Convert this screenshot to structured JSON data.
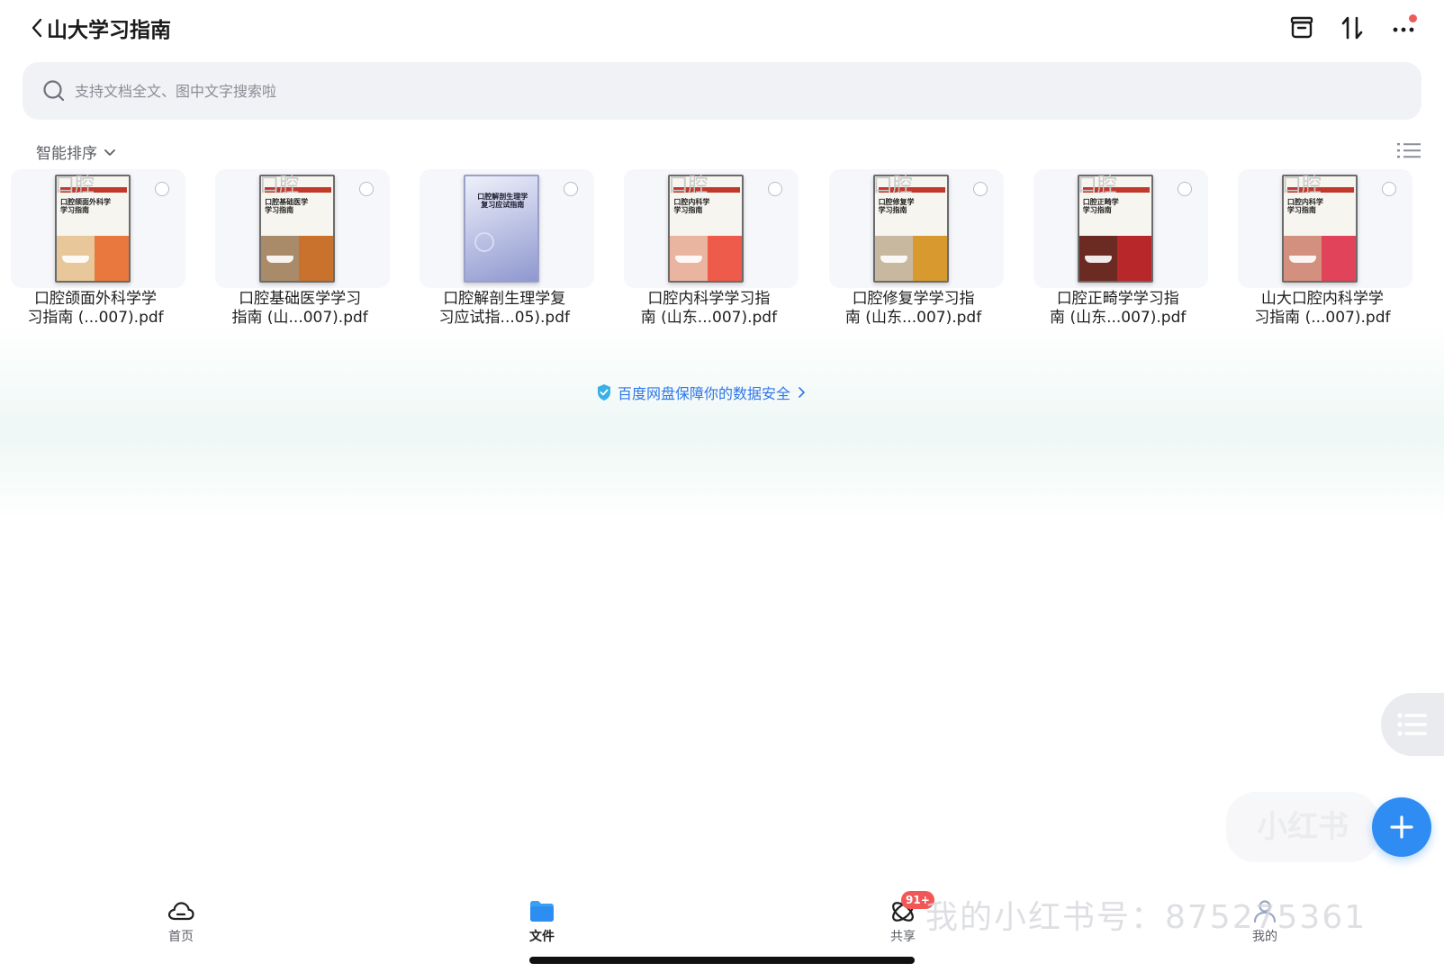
{
  "header": {
    "title": "山大学习指南",
    "icons": [
      "back-chevron-icon",
      "archive-box-icon",
      "sort-arrows-icon",
      "more-dots-icon"
    ]
  },
  "search": {
    "placeholder": "支持文档全文、图中文字搜索啦"
  },
  "sort": {
    "label": "智能排序"
  },
  "files": [
    {
      "name": "口腔颌面外科学学习指南 (...007).pdf",
      "line1": "口腔颌面外科学学",
      "line2": "习指南 (...007).pdf",
      "cover_word": "口腔",
      "cover_title": "口腔颌面外科学\n学习指南",
      "left_color": "#e8c79a",
      "right_color": "#e8783e"
    },
    {
      "name": "口腔基础医学学习指南 (山...007).pdf",
      "line1": "口腔基础医学学习",
      "line2": "指南 (山...007).pdf",
      "cover_word": "口腔",
      "cover_title": "口腔基础医学\n学习指南",
      "left_color": "#a98b6a",
      "right_color": "#c8722e"
    },
    {
      "name": "口腔解剖生理学复习应试指...05).pdf",
      "line1": "口腔解剖生理学复",
      "line2": "习应试指...05).pdf",
      "cover_word": "",
      "cover_title": "口腔解剖生理学\n复习应试指南"
    },
    {
      "name": "口腔内科学学习指南 (山东...007).pdf",
      "line1": "口腔内科学学习指",
      "line2": "南 (山东...007).pdf",
      "cover_word": "口腔",
      "cover_title": "口腔内科学\n学习指南",
      "left_color": "#e9b4a0",
      "right_color": "#ef5b4b"
    },
    {
      "name": "口腔修复学学习指南 (山东...007).pdf",
      "line1": "口腔修复学学习指",
      "line2": "南 (山东...007).pdf",
      "cover_word": "口腔",
      "cover_title": "口腔修复学\n学习指南",
      "left_color": "#c9b8a0",
      "right_color": "#d89a2e"
    },
    {
      "name": "口腔正畸学学习指南 (山东...007).pdf",
      "line1": "口腔正畸学学习指",
      "line2": "南 (山东...007).pdf",
      "cover_word": "口腔",
      "cover_title": "口腔正畸学\n学习指南",
      "left_color": "#6b2a22",
      "right_color": "#b8282a"
    },
    {
      "name": "山大口腔内科学学习指南 (...007).pdf",
      "line1": "山大口腔内科学学",
      "line2": "习指南 (...007).pdf",
      "cover_word": "口腔",
      "cover_title": "口腔内科学\n学习指南",
      "left_color": "#d4907e",
      "right_color": "#e0435a"
    }
  ],
  "security_note": "百度网盘保障你的数据安全",
  "watermark": {
    "chip": "小红书",
    "handle": "我的小红书号：875275361"
  },
  "tabs": [
    {
      "label": "首页",
      "icon": "cloud-icon",
      "active": false
    },
    {
      "label": "文件",
      "icon": "folder-icon",
      "active": true
    },
    {
      "label": "共享",
      "icon": "share-orbit-icon",
      "active": false,
      "badge": "91+"
    },
    {
      "label": "我的",
      "icon": "profile-icon",
      "active": false
    }
  ],
  "colors": {
    "accent": "#2e8cf3",
    "link": "#2f76e8",
    "badge": "#f25757",
    "search_bg": "#f1f2f6"
  }
}
